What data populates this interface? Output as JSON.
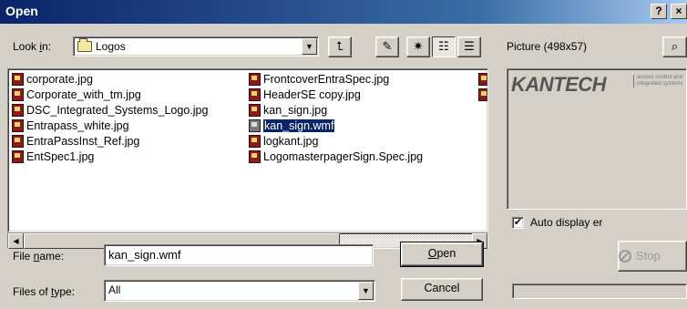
{
  "window": {
    "title": "Open",
    "help_button": "?",
    "close_button": "×"
  },
  "toolbar": {
    "look_in_label_pre": "Look ",
    "look_in_label_key": "i",
    "look_in_label_post": "n:",
    "look_in_value": "Logos",
    "look_in_icon": "folder-icon"
  },
  "files": {
    "column1": [
      "corporate.jpg",
      "Corporate_with_tm.jpg",
      "DSC_Integrated_Systems_Logo.jpg",
      "Entrapass_white.jpg",
      "EntraPassInst_Ref.jpg",
      "EntSpec1.jpg"
    ],
    "column2": [
      "FrontcoverEntraSpec.jpg",
      "HeaderSE copy.jpg",
      "kan_sign.jpg",
      "kan_sign.wmf",
      "logkant.jpg",
      "LogomasterpagerSign.Spec.jpg"
    ],
    "selected": "kan_sign.wmf"
  },
  "filename": {
    "label_pre": "File ",
    "label_key": "n",
    "label_post": "ame:",
    "value": "kan_sign.wmf"
  },
  "filetype": {
    "label_pre": "Files of ",
    "label_key": "t",
    "label_post": "ype:",
    "value": "All"
  },
  "buttons": {
    "open_key": "O",
    "open_rest": "pen",
    "cancel": "Cancel"
  },
  "preview": {
    "label": "Picture (498x57)",
    "logo_text": "KANTECH",
    "logo_subtext": "access control and integrated systems",
    "auto_display_label": "Auto display er",
    "auto_display_checked": "✔",
    "stop_label": "Stop"
  }
}
